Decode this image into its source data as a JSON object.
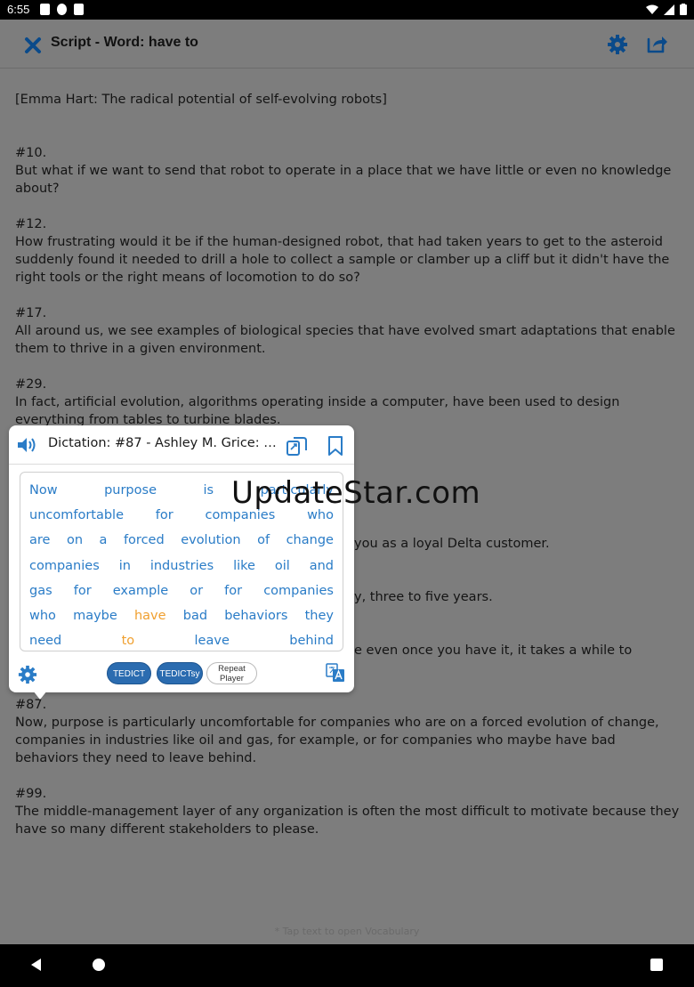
{
  "status_bar": {
    "time": "6:55"
  },
  "app_bar": {
    "title": "Script - Word: have to"
  },
  "script": {
    "heading": "[Emma Hart: The radical potential of self-evolving robots]",
    "entries": [
      {
        "num": "#10.",
        "text": "But what if we want to send that robot to operate in a place that we have little or even no knowledge about?"
      },
      {
        "num": "#12.",
        "text": "How frustrating would it be if the human-designed robot, that had taken years to get to the asteroid suddenly found it needed to drill a hole to collect a sample or clamber up a cliff but it didn't have the right tools or the right means of locomotion to do so?"
      },
      {
        "num": "#17.",
        "text": "All around us, we see examples of biological species that have evolved smart adaptations that enable them to thrive in a given environment."
      },
      {
        "num": "#29.",
        "text": "In fact, artificial evolution, algorithms operating inside a computer, have been used to design everything from tables to turbine blades."
      }
    ],
    "partial_lines": [
      "you as a loyal Delta customer.",
      "y, three to five years.",
      "e even once you have it, it takes a while to"
    ],
    "entries_after": [
      {
        "num": "#87.",
        "text": "Now, purpose is particularly uncomfortable for companies who are on a forced evolution of change, companies in industries like oil and gas, for example, or for companies who maybe have bad behaviors they need to leave behind."
      },
      {
        "num": "#99.",
        "text": "The middle-management layer of any organization is often the most difficult to motivate because they have so many different stakeholders to please."
      }
    ]
  },
  "watermark": "UpdateStar.com",
  "hint": "* Tap text to open Vocabulary",
  "popup": {
    "title": "Dictation: #87 - Ashley M. Grice: Th...",
    "lines": [
      [
        "Now",
        "purpose",
        "is",
        "particularly"
      ],
      [
        "uncomfortable",
        "for",
        "companies",
        "who"
      ],
      [
        "are",
        "on",
        "a",
        "forced",
        "evolution",
        "of",
        "change"
      ],
      [
        "companies",
        "in",
        "industries",
        "like",
        "oil",
        "and"
      ],
      [
        "gas",
        "for",
        "example",
        "or",
        "for",
        "companies"
      ],
      [
        "who",
        "maybe",
        "have",
        "bad",
        "behaviors",
        "they"
      ],
      [
        "need",
        "to",
        "leave",
        "behind"
      ]
    ],
    "highlighted_words": [
      "have",
      "to"
    ],
    "buttons": {
      "tedict": "TEDICT",
      "tedictsy": "TEDICTsy",
      "repeat_line1": "Repeat",
      "repeat_line2": "Player"
    }
  },
  "colors": {
    "accent": "#2a7cc7",
    "highlight": "#f0a030",
    "icon_blue": "#0a4a8a"
  }
}
